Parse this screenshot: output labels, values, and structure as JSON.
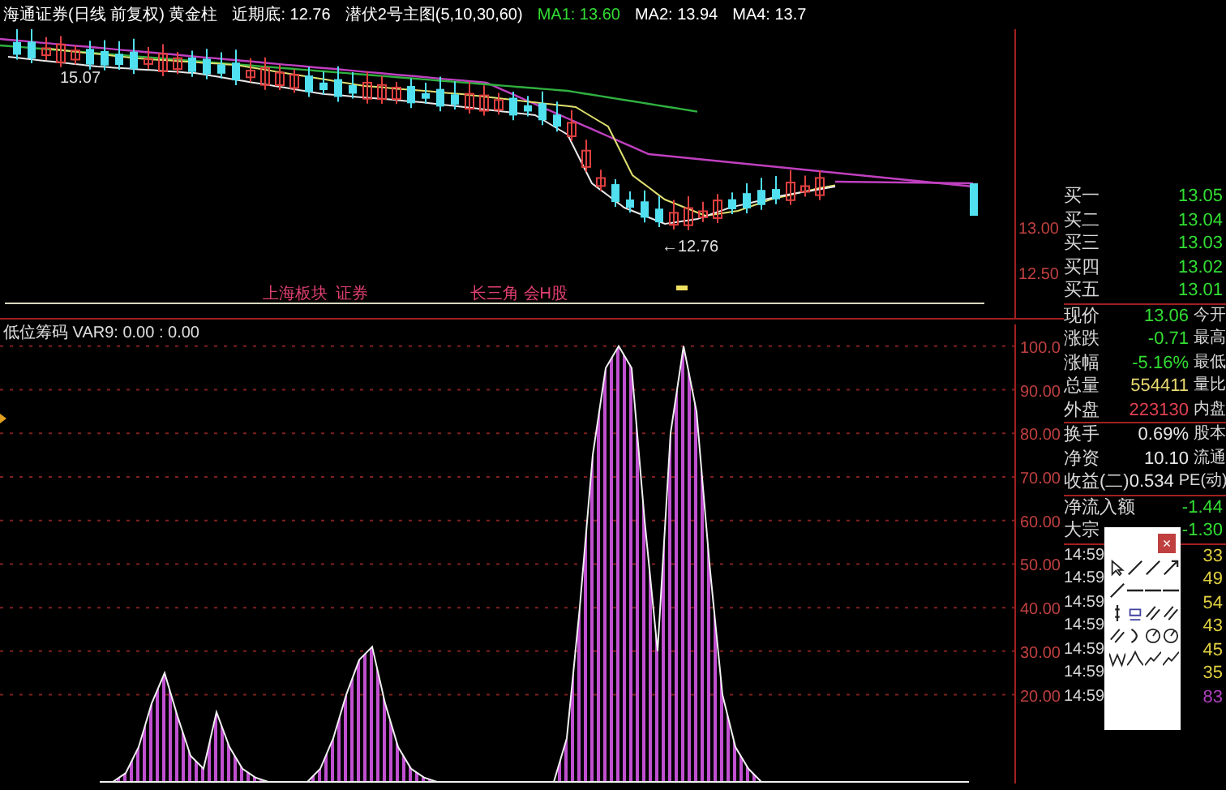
{
  "price_panel": {
    "legend": [
      {
        "text": "海通证券(日线 前复权) 黄金柱",
        "color": "#ffffff"
      },
      {
        "text": "近期底: 12.76",
        "color": "#ffffff"
      },
      {
        "text": "潜伏2号主图(5,10,30,60)",
        "color": "#ffffff"
      },
      {
        "text": "MA1: 13.60",
        "color": "#33dd33"
      },
      {
        "text": "MA2: 13.94",
        "color": "#ffffff"
      },
      {
        "text": "MA4: 13.7",
        "color": "#ffffff"
      }
    ],
    "high_label": "15.07",
    "low_label": "←12.76",
    "axis_labels": [
      "13.00",
      "12.50"
    ],
    "tags": [
      "上海板块",
      "证券",
      "长三角 会H股"
    ]
  },
  "indicator_panel": {
    "title": "低位筹码 VAR9: 0.00 : 0.00",
    "axis_labels": [
      "100.0",
      "90.00",
      "80.00",
      "70.00",
      "60.00",
      "50.00",
      "40.00",
      "30.00",
      "20.00"
    ]
  },
  "quote_panel": {
    "bids": [
      {
        "label": "买一",
        "price": "13.05"
      },
      {
        "label": "买二",
        "price": "13.04"
      },
      {
        "label": "买三",
        "price": "13.03"
      },
      {
        "label": "买四",
        "price": "13.02"
      },
      {
        "label": "买五",
        "price": "13.01"
      }
    ],
    "stats": [
      {
        "label": "现价",
        "value": "13.06",
        "extra": "今开",
        "color": "#33dd33"
      },
      {
        "label": "涨跌",
        "value": "-0.71",
        "extra": "最高",
        "color": "#33dd33"
      },
      {
        "label": "涨幅",
        "value": "-5.16%",
        "extra": "最低",
        "color": "#33dd33"
      },
      {
        "label": "总量",
        "value": "554411",
        "extra": "量比",
        "color": "#e8d870"
      },
      {
        "label": "外盘",
        "value": "223130",
        "extra": "内盘",
        "color": "#e04050"
      }
    ],
    "fundamentals": [
      {
        "label": "换手",
        "value": "0.69%",
        "extra": "股本"
      },
      {
        "label": "净资",
        "value": "10.10",
        "extra": "流通"
      },
      {
        "label": "收益(二)",
        "value": "0.534",
        "extra": "PE(动)"
      }
    ],
    "flows": [
      {
        "label": "净流入额",
        "value": "-1.44"
      },
      {
        "label": "大宗",
        "value": "-1.30"
      }
    ],
    "ticks": [
      {
        "time": "14:59",
        "volume": "33",
        "color": "#e0d040"
      },
      {
        "time": "14:59",
        "volume": "49",
        "color": "#e0d040"
      },
      {
        "time": "14:59",
        "volume": "54",
        "color": "#e0d040"
      },
      {
        "time": "14:59",
        "volume": "43",
        "color": "#e0d040"
      },
      {
        "time": "14:59",
        "volume": "45",
        "color": "#e0d040"
      },
      {
        "time": "14:59",
        "volume": "35",
        "color": "#e0d040"
      },
      {
        "time": "14:59",
        "volume": "83",
        "color": "#b040c0"
      }
    ]
  },
  "draw_palette": {
    "close_label": "×"
  }
}
